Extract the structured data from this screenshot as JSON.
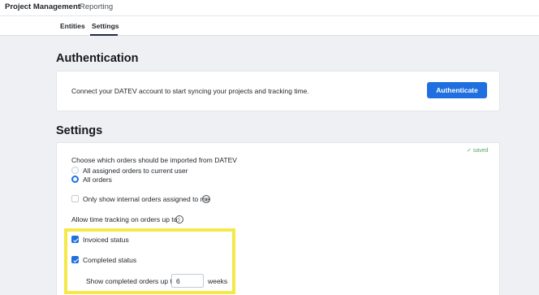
{
  "topbar": {
    "app_tabs": [
      "Project Management",
      "Reporting"
    ]
  },
  "subnav": {
    "tabs": [
      "Entities",
      "Settings"
    ],
    "active": "Settings"
  },
  "authentication": {
    "title": "Authentication",
    "description": "Connect your DATEV account to start syncing your projects and tracking time.",
    "button_label": "Authenticate"
  },
  "settings": {
    "title": "Settings",
    "saved_label": "saved",
    "import_label": "Choose which orders should be imported from DATEV",
    "import_options": [
      {
        "label": "All assigned orders to current user",
        "selected": false
      },
      {
        "label": "All orders",
        "selected": true
      }
    ],
    "internal_only_label": "Only show internal orders assigned to me",
    "internal_only_checked": false,
    "time_tracking_label": "Allow time tracking on orders up to:",
    "invoiced_label": "Invoiced status",
    "invoiced_checked": true,
    "completed_label": "Completed status",
    "completed_checked": true,
    "weeks_prefix": "Show completed orders up to",
    "weeks_value": "6",
    "weeks_suffix": "weeks"
  },
  "colors": {
    "primary": "#1f6fe0",
    "highlight": "#f5e94a",
    "saved": "#5aa469"
  }
}
